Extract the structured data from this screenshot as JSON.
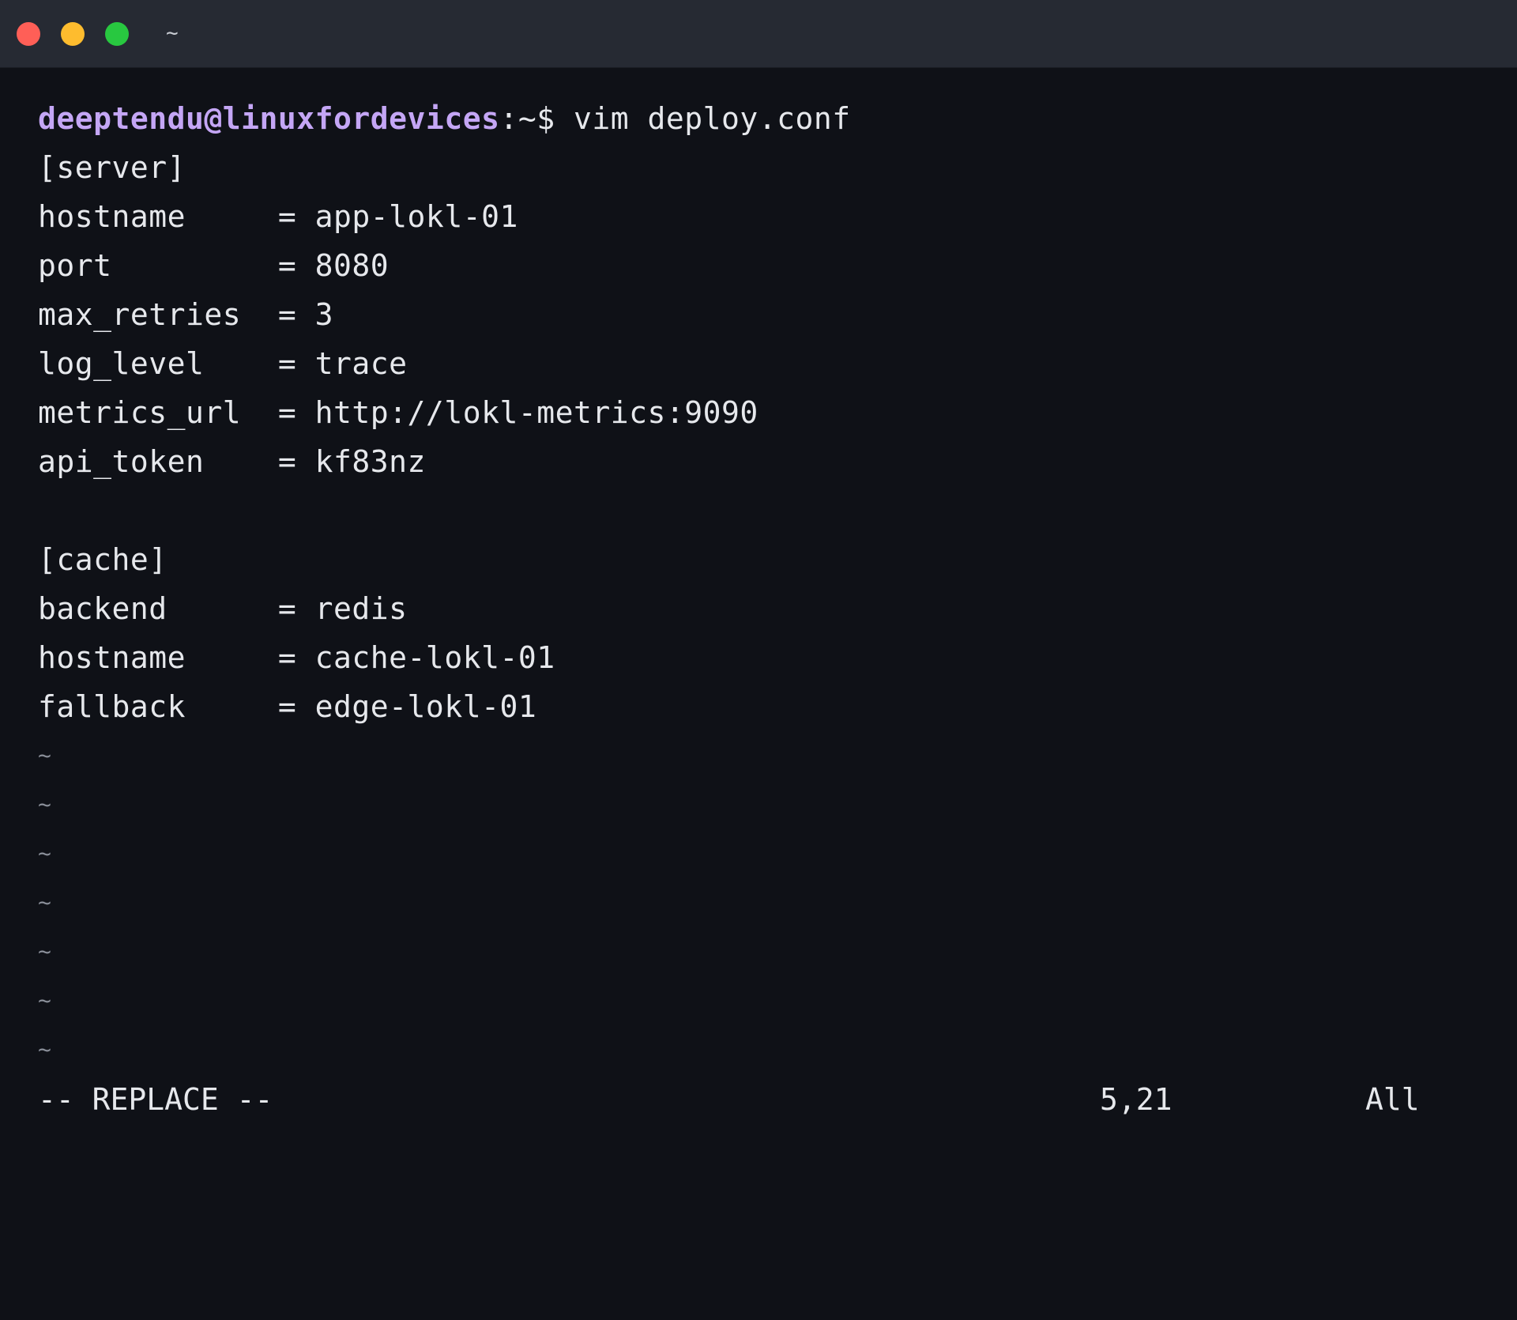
{
  "window": {
    "title": "~",
    "traffic_lights": [
      {
        "name": "close",
        "color": "#ff5f57"
      },
      {
        "name": "minimize",
        "color": "#febc2e"
      },
      {
        "name": "zoom",
        "color": "#28c840"
      }
    ]
  },
  "colors": {
    "background": "#0f1117",
    "titlebar": "#262a33",
    "text": "#e6e8ec",
    "prompt_user": "#c4a6f5",
    "tilde": "#8a8f99"
  },
  "prompt": {
    "user_host": "deeptendu@linuxfordevices",
    "path_symbol": ":~$",
    "command": " vim deploy.conf"
  },
  "buffer": {
    "lines": [
      "[server]",
      "hostname     = app-lokl-01",
      "port         = 8080",
      "max_retries  = 3",
      "log_level    = trace",
      "metrics_url  = http://lokl-metrics:9090",
      "api_token    = kf83nz",
      "",
      "[cache]",
      "backend      = redis",
      "hostname     = cache-lokl-01",
      "fallback     = edge-lokl-01"
    ],
    "empty_line_marker": "~",
    "empty_line_count": 7
  },
  "statusbar": {
    "mode": "-- REPLACE --",
    "cursor_position": "5,21",
    "scroll": "All"
  }
}
